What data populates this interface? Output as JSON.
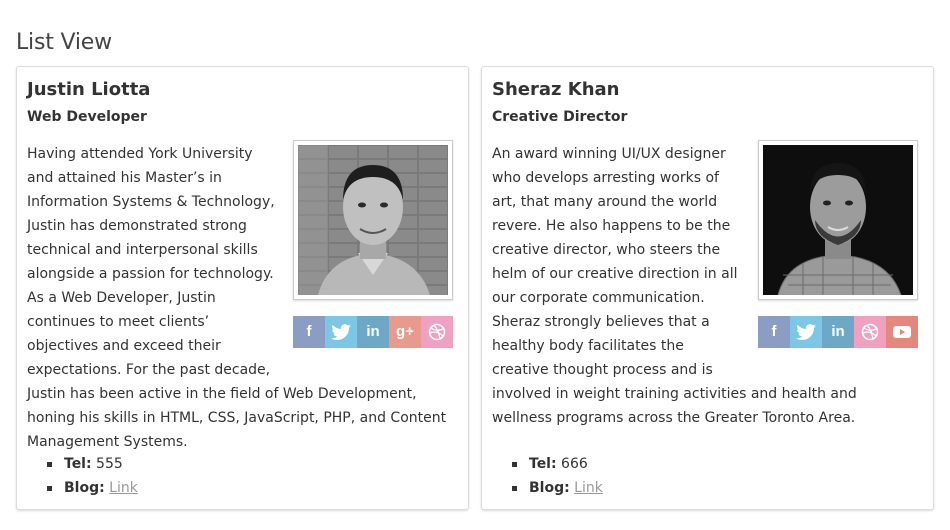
{
  "page": {
    "title": "List View"
  },
  "cards": [
    {
      "name": "Justin Liotta",
      "role": "Web Developer",
      "bio": "Having attended York University and attained his Master’s in Information Systems & Technology, Justin has demonstrated strong technical and interpersonal skills alongside a passion for technology. As a Web Developer, Justin continues to meet clients’ objectives and exceed their expectations. For the past decade, Justin has been active in the field of Web Development, honing his skills in HTML, CSS, JavaScript, PHP, and Content Management Systems.",
      "social": [
        "facebook-icon",
        "twitter-icon",
        "linkedin-icon",
        "google-plus-icon",
        "dribbble-icon"
      ],
      "tel_label": "Tel:",
      "tel": "555",
      "blog_label": "Blog:",
      "blog_link": "Link"
    },
    {
      "name": "Sheraz Khan",
      "role": "Creative Director",
      "bio": "An award winning UI/UX designer who develops arresting works of art, that many around the world revere. He also happens to be the creative director, who steers the helm of our creative direction in all our corporate communication. Sheraz strongly believes that a healthy body facilitates the creative thought process and is involved in weight training activities and health and wellness programs across the Greater Toronto Area.",
      "social": [
        "facebook-icon",
        "twitter-icon",
        "linkedin-icon",
        "dribbble-icon",
        "youtube-icon"
      ],
      "tel_label": "Tel:",
      "tel": "666",
      "blog_label": "Blog:",
      "blog_link": "Link"
    }
  ],
  "colors": {
    "facebook": "#8b9dc3",
    "twitter": "#7cc6e6",
    "linkedin": "#6ea8c7",
    "google_plus": "#e89a8c",
    "dribbble": "#f0a0c0",
    "youtube": "#e4877c",
    "link": "#999999"
  }
}
